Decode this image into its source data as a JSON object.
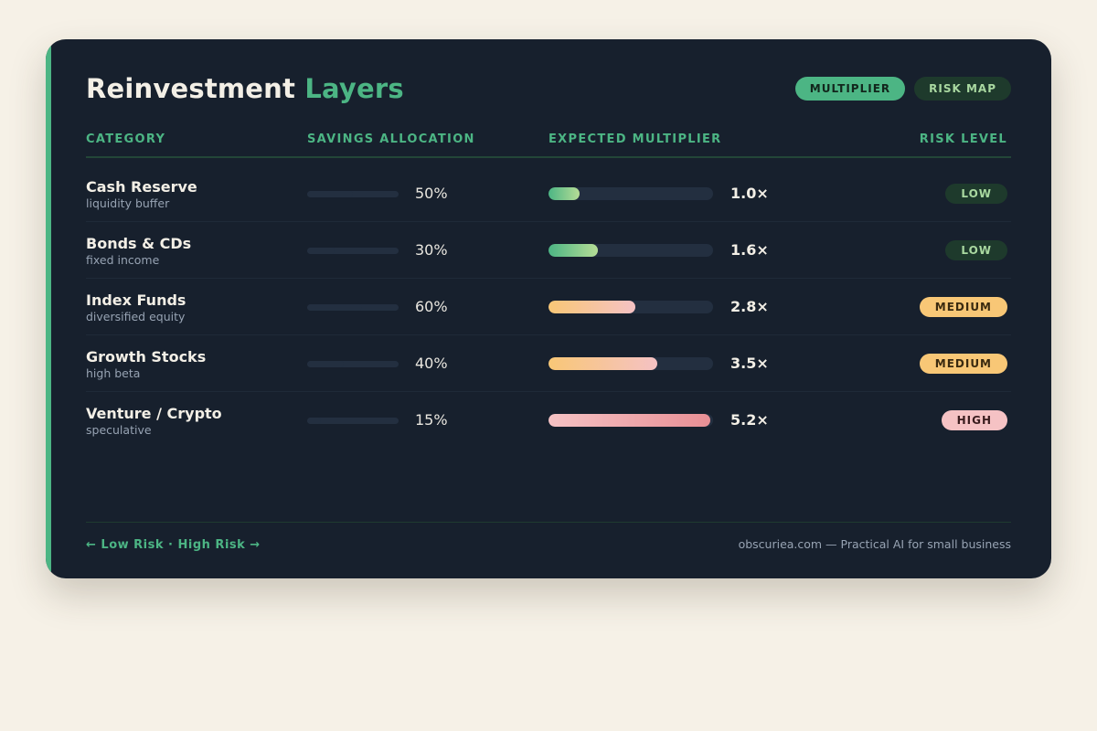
{
  "header": {
    "title_main": "Reinvestment",
    "title_highlight": "Layers",
    "pills": [
      {
        "label": "MULTIPLIER",
        "active": true
      },
      {
        "label": "RISK MAP",
        "active": false
      }
    ]
  },
  "columns": {
    "category": "CATEGORY",
    "allocation": "SAVINGS ALLOCATION",
    "multiplier": "EXPECTED MULTIPLIER",
    "risk": "RISK LEVEL"
  },
  "rows": [
    {
      "name": "Cash Reserve",
      "sub": "liquidity buffer",
      "allocation_pct": 50,
      "allocation_label": "50%",
      "multiplier": 1.0,
      "multiplier_label": "1.0×",
      "risk": "LOW",
      "risk_class": "low"
    },
    {
      "name": "Bonds & CDs",
      "sub": "fixed income",
      "allocation_pct": 30,
      "allocation_label": "30%",
      "multiplier": 1.6,
      "multiplier_label": "1.6×",
      "risk": "LOW",
      "risk_class": "low"
    },
    {
      "name": "Index Funds",
      "sub": "diversified equity",
      "allocation_pct": 60,
      "allocation_label": "60%",
      "multiplier": 2.8,
      "multiplier_label": "2.8×",
      "risk": "MEDIUM",
      "risk_class": "medium"
    },
    {
      "name": "Growth Stocks",
      "sub": "high beta",
      "allocation_pct": 40,
      "allocation_label": "40%",
      "multiplier": 3.5,
      "multiplier_label": "3.5×",
      "risk": "MEDIUM",
      "risk_class": "medium"
    },
    {
      "name": "Venture / Crypto",
      "sub": "speculative",
      "allocation_pct": 15,
      "allocation_label": "15%",
      "multiplier": 5.2,
      "multiplier_label": "5.2×",
      "risk": "HIGH",
      "risk_class": "high"
    }
  ],
  "multiplier_scale_max": 5.3,
  "risk_gradients": {
    "low": [
      "#4cb584",
      "#b6dd96"
    ],
    "medium": [
      "#f8c776",
      "#f5c2c4"
    ],
    "high": [
      "#f5c2c4",
      "#e88f95"
    ]
  },
  "footer": {
    "legend": "← Low Risk · High Risk →",
    "credit": "obscuriea.com — Practical AI for small business"
  }
}
